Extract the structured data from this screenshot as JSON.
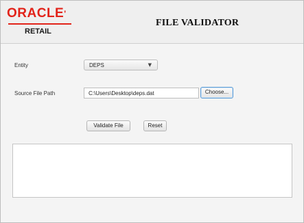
{
  "header": {
    "logo_brand": "ORACLE",
    "logo_brand_mark": "'",
    "logo_product": "RETAIL",
    "title": "FILE VALIDATOR"
  },
  "form": {
    "entity_label": "Entity",
    "entity_value": "DEPS",
    "source_label": "Source File Path",
    "source_value": "C:\\Users\\Desktop\\deps.dat",
    "choose_label": "Choose...",
    "validate_label": "Validate File",
    "reset_label": "Reset"
  },
  "output": {
    "text": ""
  },
  "icons": {
    "dropdown": "chevron-down-icon"
  },
  "colors": {
    "brand_red": "#e2231a",
    "focus_blue": "#5b9bd5"
  }
}
